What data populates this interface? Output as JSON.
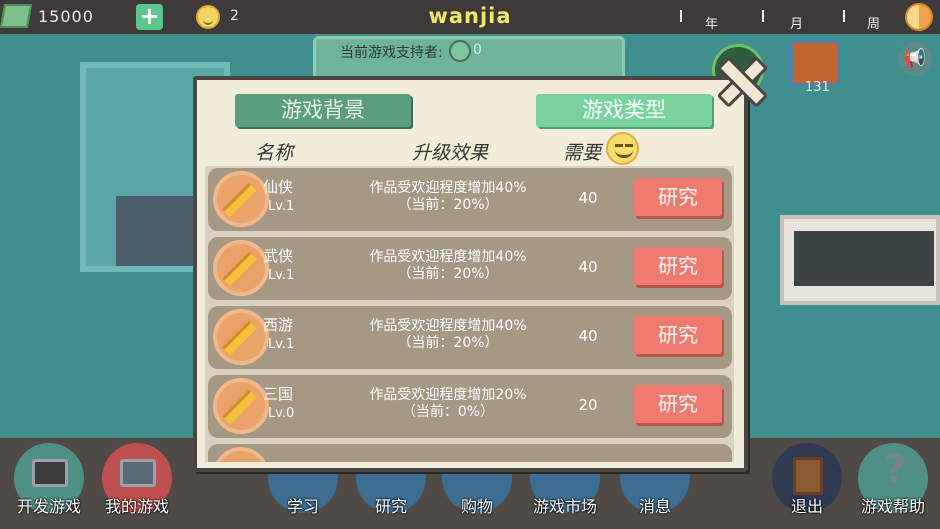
{
  "topbar": {
    "money": "15000",
    "money_icon": "cash-icon",
    "add_icon": "+",
    "fans": "2",
    "title": "wanjia",
    "year_label": "年",
    "month_label": "月",
    "week_label": "周"
  },
  "board": {
    "text": "当前游戏支持者:",
    "count": "0"
  },
  "right_icons": {
    "gift_count": "131"
  },
  "modal": {
    "tab_background": "游戏背景",
    "tab_type": "游戏类型",
    "col_name": "名称",
    "col_effect": "升级效果",
    "col_need": "需要",
    "rows": [
      {
        "name": "仙侠",
        "level": "Lv.1",
        "effect": "作品受欢迎程度增加40%",
        "current": "（当前：20%）",
        "need": "40",
        "button": "研究"
      },
      {
        "name": "武侠",
        "level": "Lv.1",
        "effect": "作品受欢迎程度增加40%",
        "current": "（当前：20%）",
        "need": "40",
        "button": "研究"
      },
      {
        "name": "西游",
        "level": "Lv.1",
        "effect": "作品受欢迎程度增加40%",
        "current": "（当前：20%）",
        "need": "40",
        "button": "研究"
      },
      {
        "name": "三国",
        "level": "Lv.0",
        "effect": "作品受欢迎程度增加20%",
        "current": "（当前：0%）",
        "need": "20",
        "button": "研究"
      },
      {
        "name": "",
        "level": "",
        "effect": "",
        "current": "",
        "need": "",
        "button": ""
      }
    ]
  },
  "bottom": {
    "develop": "开发游戏",
    "my_games": "我的游戏",
    "study": "学习",
    "research": "研究",
    "shop": "购物",
    "market": "游戏市场",
    "news": "消息",
    "exit": "退出",
    "help": "游戏帮助"
  },
  "colors": {
    "accent_green": "#79d39e",
    "button_red": "#f07a6e",
    "title_yellow": "#f2e66a"
  }
}
